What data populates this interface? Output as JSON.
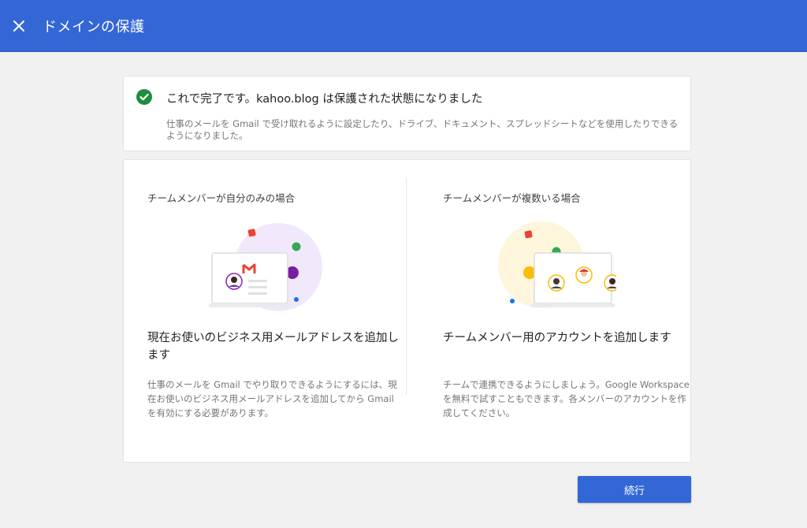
{
  "header": {
    "title": "ドメインの保護",
    "background_color": "#3367d6"
  },
  "success": {
    "title": "これで完了です。kahoo.blog は保護された状態になりました",
    "description": "仕事のメールを Gmail で受け取れるように設定したり、ドライブ、ドキュメント、スプレッドシートなどを使用したりできるようになりました。",
    "check_color": "#1e8e3e"
  },
  "options": {
    "left": {
      "heading": "チームメンバーが自分のみの場合",
      "title": "現在お使いのビジネス用メールアドレスを追加します",
      "description": "仕事のメールを Gmail でやり取りできるようにするには、現在お使いのビジネス用メールアドレスを追加してから Gmail を有効にする必要があります。"
    },
    "right": {
      "heading": "チームメンバーが複数いる場合",
      "title": "チームメンバー用のアカウントを追加します",
      "description": "チームで連携できるようにしましょう。Google Workspace を無料で試すこともできます。各メンバーのアカウントを作成してください。"
    }
  },
  "actions": {
    "continue_label": "続行",
    "button_color": "#3367d6"
  }
}
